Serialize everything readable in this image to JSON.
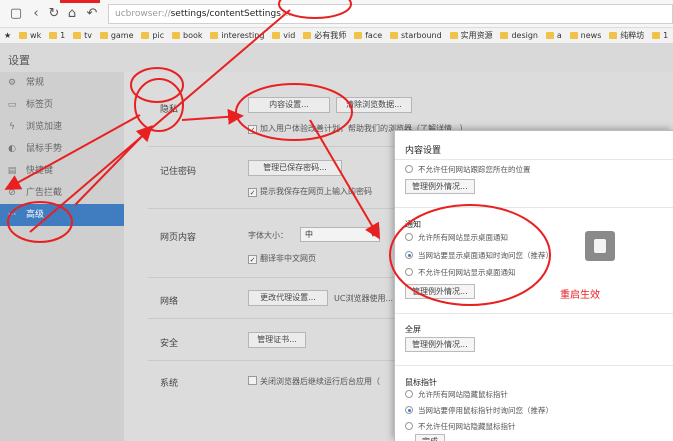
{
  "browser": {
    "url_prefix": "ucbrowser://",
    "url_path": "settings/contentSettings",
    "url_suffix": "?..."
  },
  "bookmarks": [
    {
      "label": "wk"
    },
    {
      "label": "1"
    },
    {
      "label": "tv"
    },
    {
      "label": "game"
    },
    {
      "label": "pic"
    },
    {
      "label": "book"
    },
    {
      "label": "interesting"
    },
    {
      "label": "vid"
    },
    {
      "label": "必有我师"
    },
    {
      "label": "face"
    },
    {
      "label": "starbound"
    },
    {
      "label": "实用资源"
    },
    {
      "label": "design"
    },
    {
      "label": "a"
    },
    {
      "label": "news"
    },
    {
      "label": "纯粹坊"
    },
    {
      "label": "1"
    }
  ],
  "settings": {
    "page_title": "设置",
    "sidebar": [
      {
        "label": "常规",
        "icon": "gear-icon"
      },
      {
        "label": "标签页",
        "icon": "tab-icon"
      },
      {
        "label": "浏览加速",
        "icon": "bolt-icon"
      },
      {
        "label": "鼠标手势",
        "icon": "mouse-icon"
      },
      {
        "label": "快捷键",
        "icon": "keyboard-icon"
      },
      {
        "label": "广告拦截",
        "icon": "block-icon"
      },
      {
        "label": "高级",
        "icon": "more-icon"
      }
    ],
    "sections": {
      "privacy": {
        "label": "隐私",
        "content_settings_btn": "内容设置...",
        "clear_data_btn": "清除浏览数据...",
        "ux_plan_check": "加入用户体验改善计划，帮助我们的浏览器（了解详情...）"
      },
      "passwords": {
        "label": "记住密码",
        "manage_btn": "管理已保存密码...",
        "prompt_check": "提示我保存在网页上输入的密码"
      },
      "webcontent": {
        "label": "网页内容",
        "font_size_label": "字体大小：",
        "font_size_value": "中",
        "translate_check": "翻译非中文网页"
      },
      "network": {
        "label": "网络",
        "proxy_btn": "更改代理设置...",
        "proxy_note": "UC浏览器使用..."
      },
      "security": {
        "label": "安全",
        "cert_btn": "管理证书..."
      },
      "system": {
        "label": "系统",
        "bg_check": "关闭浏览器后继续运行后台应用（"
      }
    }
  },
  "dialog": {
    "title": "内容设置",
    "location": {
      "deny_option": "不允许任何网站跟踪您所在的位置",
      "manage_btn": "管理例外情况..."
    },
    "notifications": {
      "title": "通知",
      "opt_allow": "允许所有网站显示桌面通知",
      "opt_ask": "当网站要显示桌面通知时询问您（推荐）",
      "opt_deny": "不允许任何网站显示桌面通知",
      "manage_btn": "管理例外情况...",
      "selected": "opt_ask"
    },
    "annotation_note": "重启生效",
    "fullscreen": {
      "title": "全屏",
      "manage_btn": "管理例外情况..."
    },
    "mouselock": {
      "title": "鼠标指针",
      "opt_allow": "允许所有网站隐藏鼠标指针",
      "opt_ask": "当网站要停用鼠标指针时询问您（推荐）",
      "opt_deny": "不允许任何网站隐藏鼠标指针",
      "done_btn": "完成",
      "selected": "opt_ask"
    }
  },
  "colors": {
    "accent": "#3f7cc0",
    "annotation": "#e82020"
  }
}
